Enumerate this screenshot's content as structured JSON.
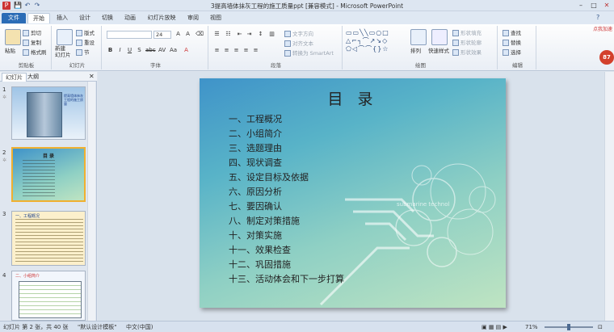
{
  "window": {
    "title": "3提高墙体抹灰工程的施工质量ppt [兼容模式] - Microsoft PowerPoint"
  },
  "qat": {
    "save": "💾",
    "undo": "↶",
    "redo": "↷"
  },
  "tabs": [
    "文件",
    "开始",
    "插入",
    "设计",
    "切换",
    "动画",
    "幻灯片放映",
    "审阅",
    "视图"
  ],
  "ribbon": {
    "clipboard": {
      "paste": "粘贴",
      "cut": "剪切",
      "copy": "复制",
      "format_painter": "格式刷",
      "label": "剪贴板"
    },
    "slides": {
      "new_slide": "新建\n幻灯片",
      "layout": "版式",
      "reset": "重设",
      "section": "节",
      "label": "幻灯片"
    },
    "font": {
      "size": "24",
      "label": "字体"
    },
    "paragraph": {
      "text_direction": "文字方向",
      "align_text": "对齐文本",
      "smartart": "转换为 SmartArt",
      "label": "段落"
    },
    "drawing": {
      "arrange": "排列",
      "quick_styles": "快速样式",
      "shape_fill": "形状填充",
      "shape_outline": "形状轮廓",
      "shape_effects": "形状效果",
      "label": "绘图"
    },
    "editing": {
      "find": "查找",
      "replace": "替换",
      "select": "选择",
      "label": "编辑"
    },
    "badge_text": "点我加速",
    "badge_num": "87"
  },
  "left_panel": {
    "tab_slides": "幻灯片",
    "tab_outline": "大纲",
    "thumbs": [
      {
        "num": "1",
        "title": "提高墙体抹灰工程的施工质量"
      },
      {
        "num": "2",
        "title": "目 录"
      },
      {
        "num": "3",
        "title": "一、工程概况"
      },
      {
        "num": "4",
        "title": "二、小组简介"
      }
    ]
  },
  "slide": {
    "title": "目  录",
    "items": [
      "一、工程概况",
      "二、小组简介",
      "三、选题理由",
      "四、现状调查",
      "五、设定目标及依据",
      "六、原因分析",
      "七、要因确认",
      "八、制定对策措施",
      "十、对策实施",
      "十一、效果检查",
      "十二、巩固措施",
      "十三、活动体会和下一步打算"
    ],
    "watermark": "submarine technol"
  },
  "status": {
    "slide_info": "幻灯片 第 2 张，共 40 张",
    "theme": "\"默认设计模板\"",
    "language": "中文(中国)",
    "zoom": "71%"
  },
  "colors": {
    "accent": "#2b6cb6",
    "file_tab": "#2b6cb6"
  }
}
